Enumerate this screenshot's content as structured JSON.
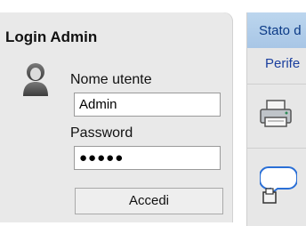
{
  "login": {
    "title": "Login Admin",
    "username_label": "Nome utente",
    "username_value": "Admin",
    "password_label": "Password",
    "password_value": "●●●●●",
    "submit_label": "Accedi"
  },
  "side": {
    "status_title": "Stato d",
    "link_label": "Perife"
  },
  "icons": [
    "user-icon",
    "printer-icon",
    "chat-bubble-icon"
  ]
}
